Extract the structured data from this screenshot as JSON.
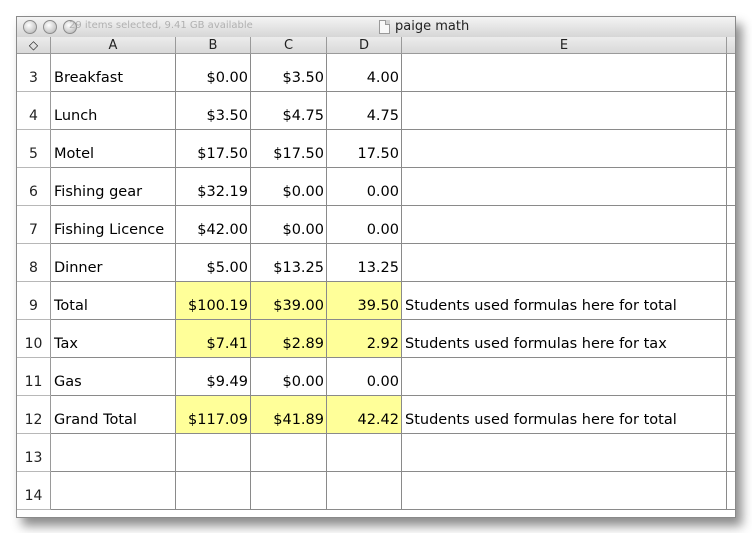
{
  "window": {
    "status_text": "29 items selected, 9.41 GB available",
    "title": "paige math"
  },
  "corner_icon": "◇",
  "columns": [
    "A",
    "B",
    "C",
    "D",
    "E"
  ],
  "highlight_color": "#ffff99",
  "rows": [
    {
      "num": "3",
      "a": "Breakfast",
      "b": "$0.00",
      "c": "$3.50",
      "d": "4.00",
      "e": ""
    },
    {
      "num": "4",
      "a": "Lunch",
      "b": "$3.50",
      "c": "$4.75",
      "d": "4.75",
      "e": ""
    },
    {
      "num": "5",
      "a": "Motel",
      "b": "$17.50",
      "c": "$17.50",
      "d": "17.50",
      "e": ""
    },
    {
      "num": "6",
      "a": "Fishing gear",
      "b": "$32.19",
      "c": "$0.00",
      "d": "0.00",
      "e": ""
    },
    {
      "num": "7",
      "a": "Fishing Licence",
      "b": "$42.00",
      "c": "$0.00",
      "d": "0.00",
      "e": ""
    },
    {
      "num": "8",
      "a": "Dinner",
      "b": "$5.00",
      "c": "$13.25",
      "d": "13.25",
      "e": ""
    },
    {
      "num": "9",
      "a": "Total",
      "b": "$100.19",
      "c": "$39.00",
      "d": "39.50",
      "e": "Students used formulas here for total",
      "hl": true
    },
    {
      "num": "10",
      "a": "Tax",
      "b": "$7.41",
      "c": "$2.89",
      "d": "2.92",
      "e": "Students used formulas here for tax",
      "hl": true
    },
    {
      "num": "11",
      "a": "Gas",
      "b": "$9.49",
      "c": "$0.00",
      "d": "0.00",
      "e": ""
    },
    {
      "num": "12",
      "a": "Grand Total",
      "b": "$117.09",
      "c": "$41.89",
      "d": "42.42",
      "e": "Students used formulas here for total",
      "hl": true
    },
    {
      "num": "13",
      "a": "",
      "b": "",
      "c": "",
      "d": "",
      "e": ""
    },
    {
      "num": "14",
      "a": "",
      "b": "",
      "c": "",
      "d": "",
      "e": ""
    }
  ]
}
